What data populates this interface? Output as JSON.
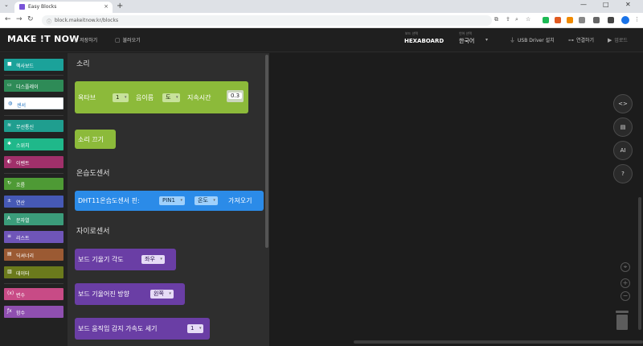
{
  "browser": {
    "tab_title": "Easy Blocks",
    "tab_close": "×",
    "new_tab": "+",
    "url": "block.makeitnow.kr/blocks",
    "window_controls": [
      "—",
      "□",
      "✕"
    ],
    "chevron": "⌄"
  },
  "app": {
    "logo": "MAKE !T NOW",
    "save_label": "저장하기",
    "open_label": "불러오기",
    "board": {
      "caption": "보드 선택",
      "value": "HEXABOARD"
    },
    "language": {
      "caption": "언어 선택",
      "value": "한국어"
    },
    "usb_label": "USB Driver 설치",
    "connect_label": "연결하기",
    "upload_label": "업로드"
  },
  "categories": [
    {
      "label": "헥사보드",
      "icon": "■",
      "color": "#1ba29a"
    },
    {
      "label": "디스플레이",
      "icon": "▭",
      "color": "#2e8b57"
    },
    {
      "label": "센서",
      "icon": "◍",
      "color": "#ffffff",
      "selected": true
    },
    {
      "label": "무선통신",
      "icon": "≋",
      "color": "#1f9e8f"
    },
    {
      "label": "스위치",
      "icon": "✱",
      "color": "#1fb88a"
    },
    {
      "label": "이벤트",
      "icon": "◐",
      "color": "#a0306a"
    },
    {
      "label": "흐름",
      "icon": "↻",
      "color": "#4e9a35"
    },
    {
      "label": "연산",
      "icon": "±",
      "color": "#4659b5"
    },
    {
      "label": "문자열",
      "icon": "A",
      "color": "#3b9c7a"
    },
    {
      "label": "리스트",
      "icon": "≡",
      "color": "#6f55b8"
    },
    {
      "label": "딕셔너리",
      "icon": "▤",
      "color": "#9b5a33"
    },
    {
      "label": "데이터",
      "icon": "▥",
      "color": "#6b7a1c"
    },
    {
      "label": "변수",
      "icon": "(x)",
      "color": "#c84b86"
    },
    {
      "label": "함수",
      "icon": "ƒx",
      "color": "#8f4fb0"
    }
  ],
  "flyout": {
    "sections": [
      "소리",
      "온습도센서",
      "자이로센서"
    ],
    "blocks": {
      "tone": {
        "prefix": "옥타브",
        "octave": "1",
        "middle": "음이름",
        "note": "도",
        "suffix": "지속시간",
        "duration": "0.3"
      },
      "stop": {
        "label": "소리 끄기"
      },
      "dht": {
        "prefix": "DHT11온습도센서 핀:",
        "pin": "PIN1",
        "mode": "온도",
        "suffix": "가져오기"
      },
      "tilt_angle": {
        "prefix": "보드 기울기 각도",
        "axis": "좌우"
      },
      "tilt_dir": {
        "prefix": "보드 기울어진 방향",
        "dir": "왼쪽"
      },
      "motion": {
        "prefix": "보드 움직임 감지 가속도 세기",
        "level": "1"
      }
    }
  },
  "workspace": {
    "tools": [
      "<>",
      "▤",
      "AI",
      "?"
    ],
    "zoom": [
      "⌖",
      "+",
      "−"
    ]
  },
  "colors": {
    "sound_block": "#8cba3a",
    "sensor_block": "#2b8be8",
    "gyro_block": "#6a3ea5",
    "selected_category_text": "#1a6fbf"
  }
}
